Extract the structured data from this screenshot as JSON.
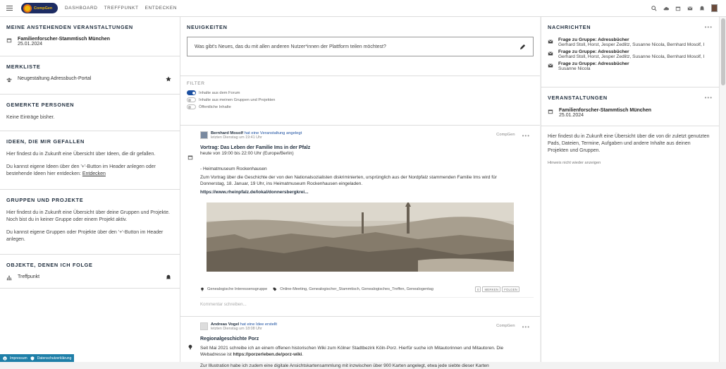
{
  "topbar": {
    "logo_text": "CompGen",
    "nav": [
      "DASHBOARD",
      "TREFFPUNKT",
      "ENTDECKEN"
    ],
    "icons": [
      "search-icon",
      "cloud-icon",
      "calendar-icon",
      "mail-icon",
      "bell-icon",
      "avatar"
    ]
  },
  "left": {
    "events_title": "MEINE ANSTEHENDEN VERANSTALTUNGEN",
    "event_name": "Familienforscher-Stammtisch München",
    "event_date": "25.01.2024",
    "watch_title": "MERKLISTE",
    "watch_item": "Neugestaltung Adressbuch-Portal",
    "persons_title": "GEMERKTE PERSONEN",
    "persons_empty": "Keine Einträge bisher.",
    "ideas_title": "IDEEN, DIE MIR GEFALLEN",
    "ideas_p1": "Hier findest du in Zukunft eine Übersicht über Ideen, die dir gefallen.",
    "ideas_p2a": "Du kannst eigene Ideen über den '+'-Button im Header anlegen oder bestehende Ideen hier entdecken:",
    "ideas_link": "Entdecken",
    "groups_title": "GRUPPEN UND PROJEKTE",
    "groups_p1": "Hier findest du in Zukunft eine Übersicht über deine Gruppen und Projekte. Noch bist du in keiner Gruppe oder einem Projekt aktiv.",
    "groups_p2": "Du kannst eigene Gruppen oder Projekte über den '+'-Button im Header anlegen.",
    "follow_title": "OBJEKTE, DENEN ICH FOLGE",
    "follow_item": "Treffpunkt"
  },
  "mid": {
    "news_title": "NEUIGKEITEN",
    "composer_placeholder": "Was gibt's Neues, das du mit allen anderen Nutzer*innen der Plattform teilen möchtest?",
    "filter_title": "FILTER",
    "filters": [
      "Inhalte aus dem Forum",
      "Inhalte aus meinen Gruppen und Projekten",
      "Öffentliche Inhalte"
    ],
    "filter_states": [
      true,
      false,
      false
    ]
  },
  "post1": {
    "author": "Bernhard Mosolf",
    "action": "hat eine Veranstaltung angelegt",
    "date": "letzten Dienstag um 19:41 Uhr",
    "source": "CompGen",
    "title": "Vortrag: Das Leben der Familie Ims in der Pfalz",
    "time": "heute von 19:00 bis 22:00 Uhr (Europe/Berlin)",
    "place": "- Heimatmuseum Rockenhausen",
    "text": "Zum Vortrag über die Geschichte der von den Nationalsozialisten diskriminierten, ursprünglich aus der Nordpfalz stammenden Familie Ims wird für Donnerstag, 18. Januar, 19 Uhr, ins Heimatmuseum Rockenhausen eingeladen.",
    "link": "https://www.rheinpfalz.de/lokal/donnersbergkrei...",
    "group": "Genealogische Interessensgruppe",
    "tags": "Online-Meeting, Genealogischer_Stammtisch, Genealogisches_Treffen, Genealogentag",
    "btn_count": "0",
    "btn_watch": "MERKEN",
    "btn_follow": "FOLGEN",
    "comment_placeholder": "Kommentar schreiben..."
  },
  "post2": {
    "author": "Andreas Vogel",
    "action": "hat eine Idee erstellt",
    "date": "letzten Dienstag um 18:08 Uhr",
    "source": "CompGen",
    "title": "Regionalgeschichte Porz",
    "text_a": "Seit Mai 2021 schreibe ich an einem offenen historischen Wiki zum Kölner Stadtbezirk Köln-Porz. Hierfür suche ich Mitautorinnen und Mitautoren. Die Webadresse ist",
    "link": "https://porzerleben.de/porz-wiki",
    "text_b": "Zur Illustration habe ich zudem eine digitale Ansichtskartensammlung mit inzwischen über 900 Karten angelegt, etwa jede siebte dieser Karten"
  },
  "right": {
    "msgs_title": "NACHRICHTEN",
    "msgs": [
      {
        "title": "Frage zu Gruppe: Adressbücher",
        "sub": "Gerhard Stoll, Horst, Jesper Zedlitz, Susanne Nicola, Bernhard Mosolf, I"
      },
      {
        "title": "Frage zu Gruppe: Adressbücher",
        "sub": "Gerhard Stoll, Horst, Jesper Zedlitz, Susanne Nicola, Bernhard Mosolf, I"
      },
      {
        "title": "Frage zu Gruppe: Adressbücher",
        "sub": "Susanne Nicola"
      }
    ],
    "events_title": "VERANSTALTUNGEN",
    "event_name": "Familienforscher-Stammtisch München",
    "event_date": "25.01.2024",
    "info": "Hier findest du in Zukunft eine Übersicht über die von dir zuletzt genutzten Pads, Dateien, Termine, Aufgaben und andere Inhalte aus deinen Projekten und Gruppen.",
    "hide_hint": "Hinweis nicht wieder anzeigen"
  },
  "footer": {
    "impressum": "Impressum",
    "privacy": "Datenschutzerklärung"
  }
}
